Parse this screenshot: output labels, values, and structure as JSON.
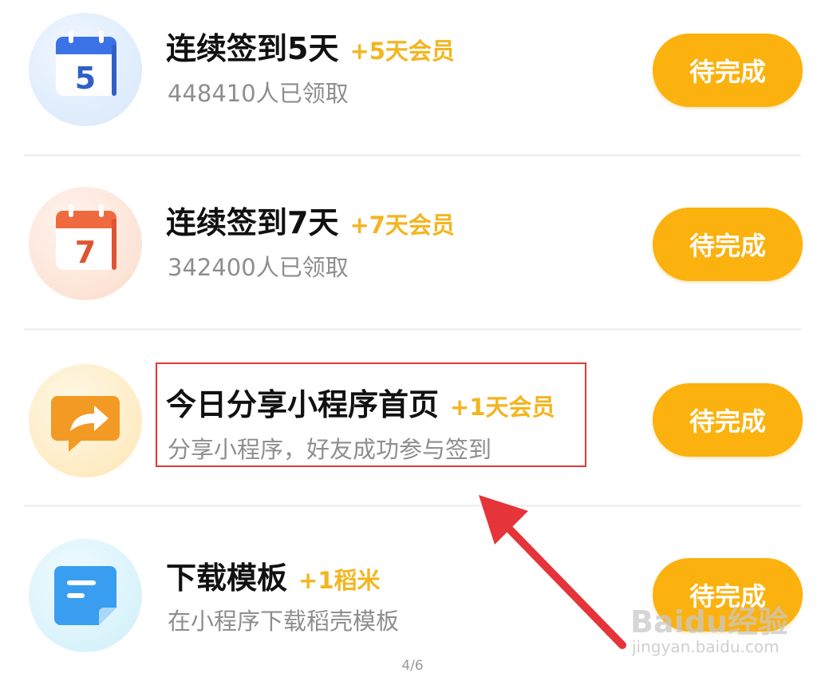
{
  "tasks": [
    {
      "title": "连续签到5天",
      "reward": "+5天会员",
      "subtitle": "448410人已领取",
      "button": "待完成",
      "icon": "calendar-icon",
      "icon_text": "5",
      "accent": "#3b73e6",
      "bg": "#d9e9fb"
    },
    {
      "title": "连续签到7天",
      "reward": "+7天会员",
      "subtitle": "342400人已领取",
      "button": "待完成",
      "icon": "calendar-icon",
      "icon_text": "7",
      "accent": "#ef6a3e",
      "bg": "#fde6dc"
    },
    {
      "title": "今日分享小程序首页",
      "reward": "+1天会员",
      "subtitle": "分享小程序，好友成功参与签到",
      "button": "待完成",
      "icon": "share-icon",
      "accent": "#f39a25",
      "bg": "#fdeec9"
    },
    {
      "title": "下载模板",
      "reward": "+1稻米",
      "subtitle": "在小程序下载稻壳模板",
      "button": "待完成",
      "icon": "document-icon",
      "accent": "#3a9ef0",
      "bg": "#d8f3fb"
    }
  ],
  "page_indicator": "4/6",
  "watermark": {
    "brand": "Baidu经验",
    "url": "jingyan.baidu.com"
  },
  "colors": {
    "button": "#fbb10e",
    "reward": "#f3b51f",
    "highlight": "#e03a3a",
    "arrow": "#e5343a"
  }
}
